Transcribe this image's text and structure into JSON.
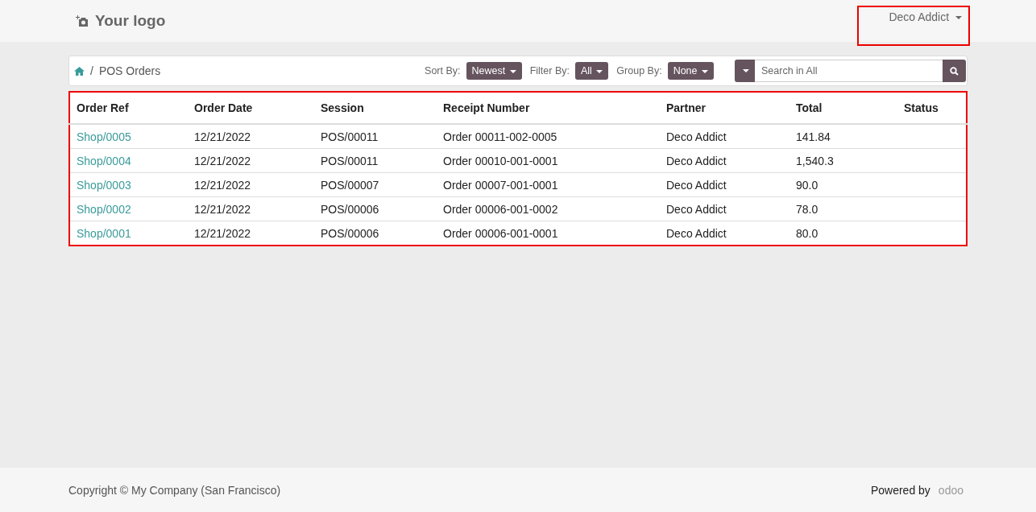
{
  "header": {
    "logo": "Your logo",
    "user": "Deco Addict"
  },
  "breadcrumb": {
    "separator": "/",
    "current": "POS Orders"
  },
  "controls": [
    {
      "label": "Sort By:",
      "value": "Newest"
    },
    {
      "label": "Filter By:",
      "value": "All"
    },
    {
      "label": "Group By:",
      "value": "None"
    }
  ],
  "search": {
    "placeholder": "Search in All"
  },
  "table": {
    "columns": [
      "Order Ref",
      "Order Date",
      "Session",
      "Receipt Number",
      "Partner",
      "Total",
      "Status"
    ],
    "rows": [
      [
        "Shop/0005",
        "12/21/2022",
        "POS/00011",
        "Order 00011-002-0005",
        "Deco Addict",
        "141.84",
        ""
      ],
      [
        "Shop/0004",
        "12/21/2022",
        "POS/00011",
        "Order 00010-001-0001",
        "Deco Addict",
        "1,540.3",
        ""
      ],
      [
        "Shop/0003",
        "12/21/2022",
        "POS/00007",
        "Order 00007-001-0001",
        "Deco Addict",
        "90.0",
        ""
      ],
      [
        "Shop/0002",
        "12/21/2022",
        "POS/00006",
        "Order 00006-001-0002",
        "Deco Addict",
        "78.0",
        ""
      ],
      [
        "Shop/0001",
        "12/21/2022",
        "POS/00006",
        "Order 00006-001-0001",
        "Deco Addict",
        "80.0",
        ""
      ]
    ]
  },
  "footer": {
    "copyright": "Copyright © My Company (San Francisco)",
    "powered_by": "Powered by",
    "brand": "odoo"
  }
}
